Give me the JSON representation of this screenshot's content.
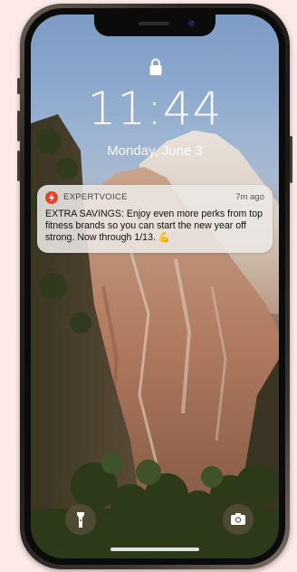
{
  "lock_screen": {
    "time": "11:44",
    "date": "Monday, June 3"
  },
  "notification": {
    "app_name": "EXPERTVOICE",
    "timestamp": "7m ago",
    "message": "EXTRA SAVINGS: Enjoy even more perks from top fitness brands so you can start the new year off strong. Now through 1/13. 💪",
    "app_icon": "lightning-bolt-icon",
    "app_icon_color": "#e8412a"
  },
  "controls": {
    "left_icon": "flashlight-icon",
    "right_icon": "camera-icon"
  },
  "colors": {
    "background": "#fde9e7"
  }
}
